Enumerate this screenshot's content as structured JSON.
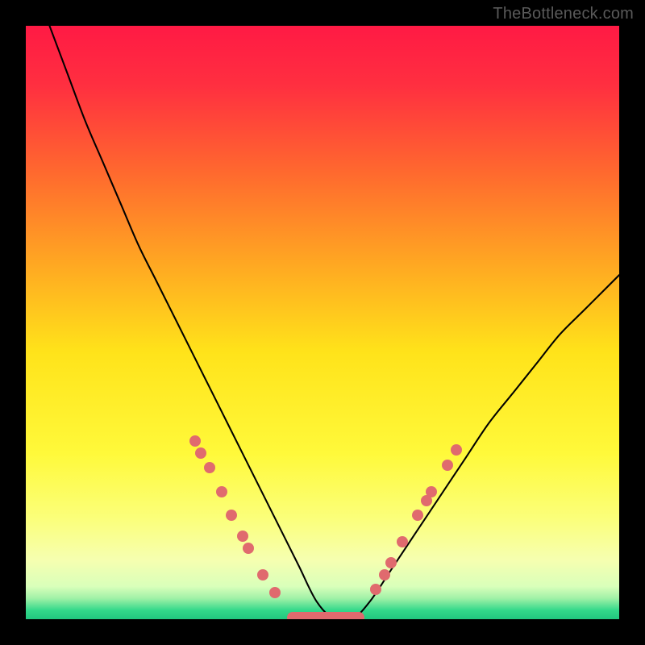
{
  "watermark": "TheBottleneck.com",
  "chart_data": {
    "type": "line",
    "title": "",
    "xlabel": "",
    "ylabel": "",
    "xlim": [
      0,
      100
    ],
    "ylim": [
      0,
      100
    ],
    "background_gradient_stops": [
      {
        "pos": 0.0,
        "color": "#ff1a44"
      },
      {
        "pos": 0.1,
        "color": "#ff2f40"
      },
      {
        "pos": 0.25,
        "color": "#ff6a2e"
      },
      {
        "pos": 0.4,
        "color": "#ffa722"
      },
      {
        "pos": 0.55,
        "color": "#ffe31a"
      },
      {
        "pos": 0.72,
        "color": "#fff93a"
      },
      {
        "pos": 0.83,
        "color": "#fbff7a"
      },
      {
        "pos": 0.9,
        "color": "#f6ffb0"
      },
      {
        "pos": 0.945,
        "color": "#d9ffba"
      },
      {
        "pos": 0.965,
        "color": "#9ff1a7"
      },
      {
        "pos": 0.985,
        "color": "#33d88a"
      },
      {
        "pos": 1.0,
        "color": "#21c77f"
      }
    ],
    "series": [
      {
        "name": "bottleneck-curve",
        "x": [
          4,
          7,
          10,
          13,
          16,
          19,
          22,
          25,
          28,
          31,
          34,
          37,
          40,
          43,
          46,
          49,
          52,
          55,
          58,
          62,
          66,
          70,
          74,
          78,
          82,
          86,
          90,
          94,
          98,
          100
        ],
        "y": [
          100,
          92,
          84,
          77,
          70,
          63,
          57,
          51,
          45,
          39,
          33,
          27,
          21,
          15,
          9,
          3,
          0,
          0,
          3,
          9,
          15,
          21,
          27,
          33,
          38,
          43,
          48,
          52,
          56,
          58
        ]
      }
    ],
    "markers_left": [
      {
        "x": 28.5,
        "y": 30
      },
      {
        "x": 29.5,
        "y": 28
      },
      {
        "x": 31.0,
        "y": 25.5
      },
      {
        "x": 33.0,
        "y": 21.5
      },
      {
        "x": 34.7,
        "y": 17.5
      },
      {
        "x": 36.5,
        "y": 14
      },
      {
        "x": 37.5,
        "y": 12
      },
      {
        "x": 40.0,
        "y": 7.5
      },
      {
        "x": 42.0,
        "y": 4.5
      }
    ],
    "markers_right": [
      {
        "x": 59.0,
        "y": 5
      },
      {
        "x": 60.5,
        "y": 7.5
      },
      {
        "x": 61.5,
        "y": 9.5
      },
      {
        "x": 63.5,
        "y": 13
      },
      {
        "x": 66.0,
        "y": 17.5
      },
      {
        "x": 67.5,
        "y": 20
      },
      {
        "x": 68.3,
        "y": 21.5
      },
      {
        "x": 71.0,
        "y": 26
      },
      {
        "x": 72.5,
        "y": 28.5
      }
    ],
    "bottom_bar": {
      "x_start": 44,
      "x_end": 57,
      "y": 0.3
    }
  }
}
